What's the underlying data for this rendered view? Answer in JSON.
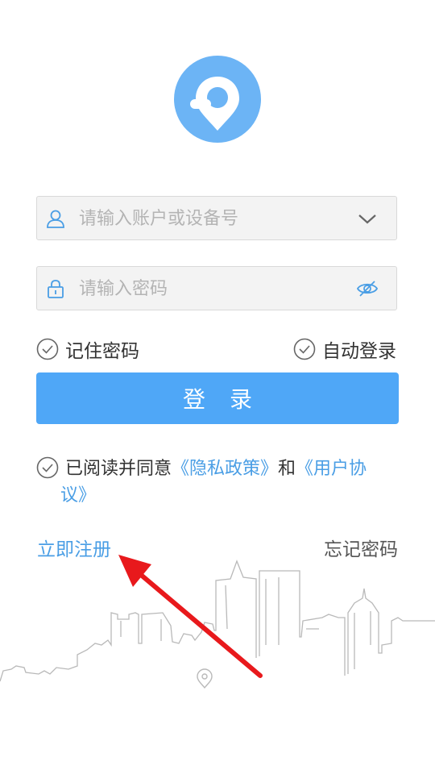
{
  "colors": {
    "accent": "#4fa7f7",
    "logo": "#6cb4f5",
    "link": "#4a9ee5",
    "annotation_arrow": "#e8191c"
  },
  "logo": {
    "icon": "location-pin-logo"
  },
  "account_field": {
    "placeholder": "请输入账户或设备号",
    "value": "",
    "lead_icon": "user-icon",
    "trail_icon": "chevron-down-icon"
  },
  "password_field": {
    "placeholder": "请输入密码",
    "value": "",
    "lead_icon": "lock-icon",
    "trail_icon": "eye-icon"
  },
  "options": {
    "remember_password": "记住密码",
    "auto_login": "自动登录"
  },
  "login_button": "登录",
  "agreement": {
    "prefix": "已阅读并同意",
    "privacy_link": "《隐私政策》",
    "and": "和",
    "user_agreement_link_part1": "《用户协",
    "user_agreement_link_part2": "议》"
  },
  "links": {
    "register": "立即注册",
    "forgot_password": "忘记密码"
  }
}
